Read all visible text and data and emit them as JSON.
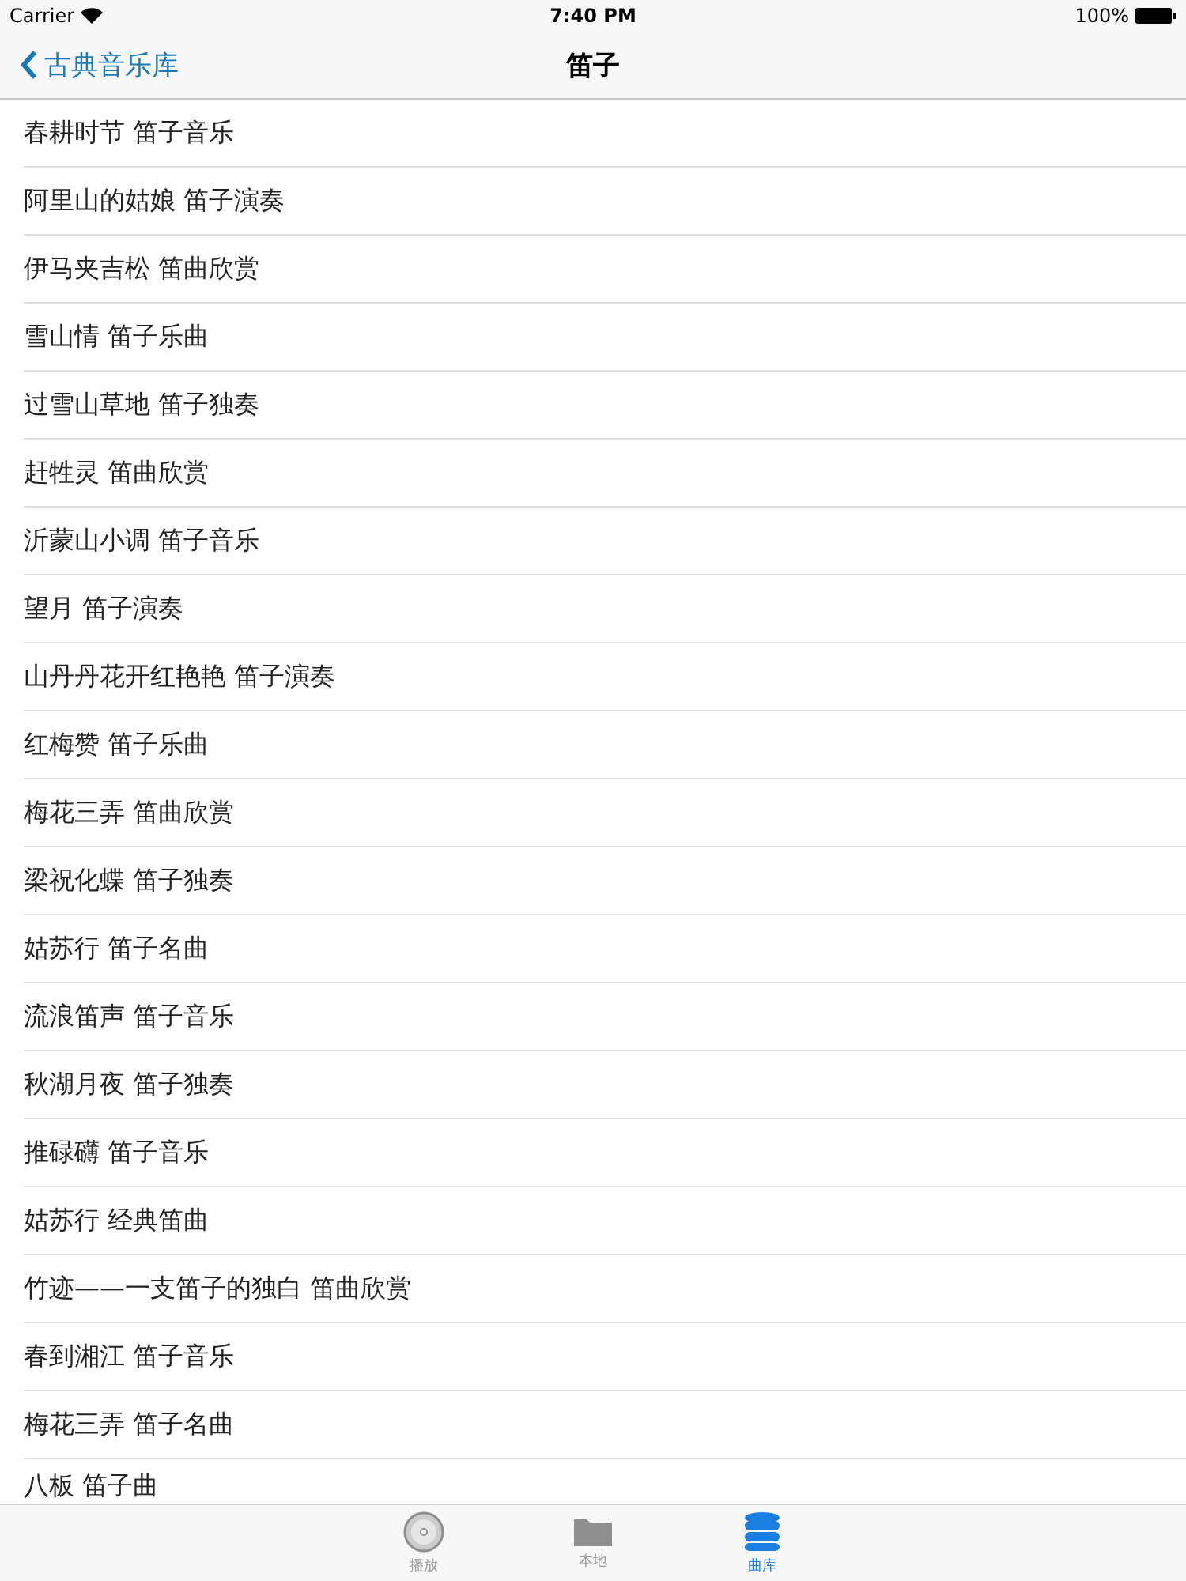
{
  "status_bar": {
    "carrier": "Carrier",
    "time": "7:40 PM",
    "battery": "100%"
  },
  "nav_bar": {
    "back": "古典音乐库",
    "title": "笛子"
  },
  "rows": [
    "春耕时节 笛子音乐",
    "阿里山的姑娘 笛子演奏",
    "伊马夹吉松 笛曲欣赏",
    "雪山情 笛子乐曲",
    "过雪山草地 笛子独奏",
    "赶牲灵 笛曲欣赏",
    "沂蒙山小调 笛子音乐",
    "望月 笛子演奏",
    "山丹丹花开红艳艳 笛子演奏",
    "红梅赞 笛子乐曲",
    "梅花三弄 笛曲欣赏",
    "梁祝化蝶 笛子独奏",
    "姑苏行 笛子名曲",
    "流浪笛声 笛子音乐",
    "秋湖月夜 笛子独奏",
    "推碌礴 笛子音乐",
    "姑苏行 经典笛曲",
    "竹迹——一支笛子的独白 笛曲欣赏",
    "春到湘江 笛子音乐",
    "梅花三弄 笛子名曲",
    "八板 笛子曲"
  ],
  "tab_bar": [
    {
      "kind": "disc",
      "label": "播放",
      "selected": false
    },
    {
      "kind": "folder",
      "label": "本地",
      "selected": false
    },
    {
      "kind": "database",
      "label": "曲库",
      "selected": true
    }
  ]
}
